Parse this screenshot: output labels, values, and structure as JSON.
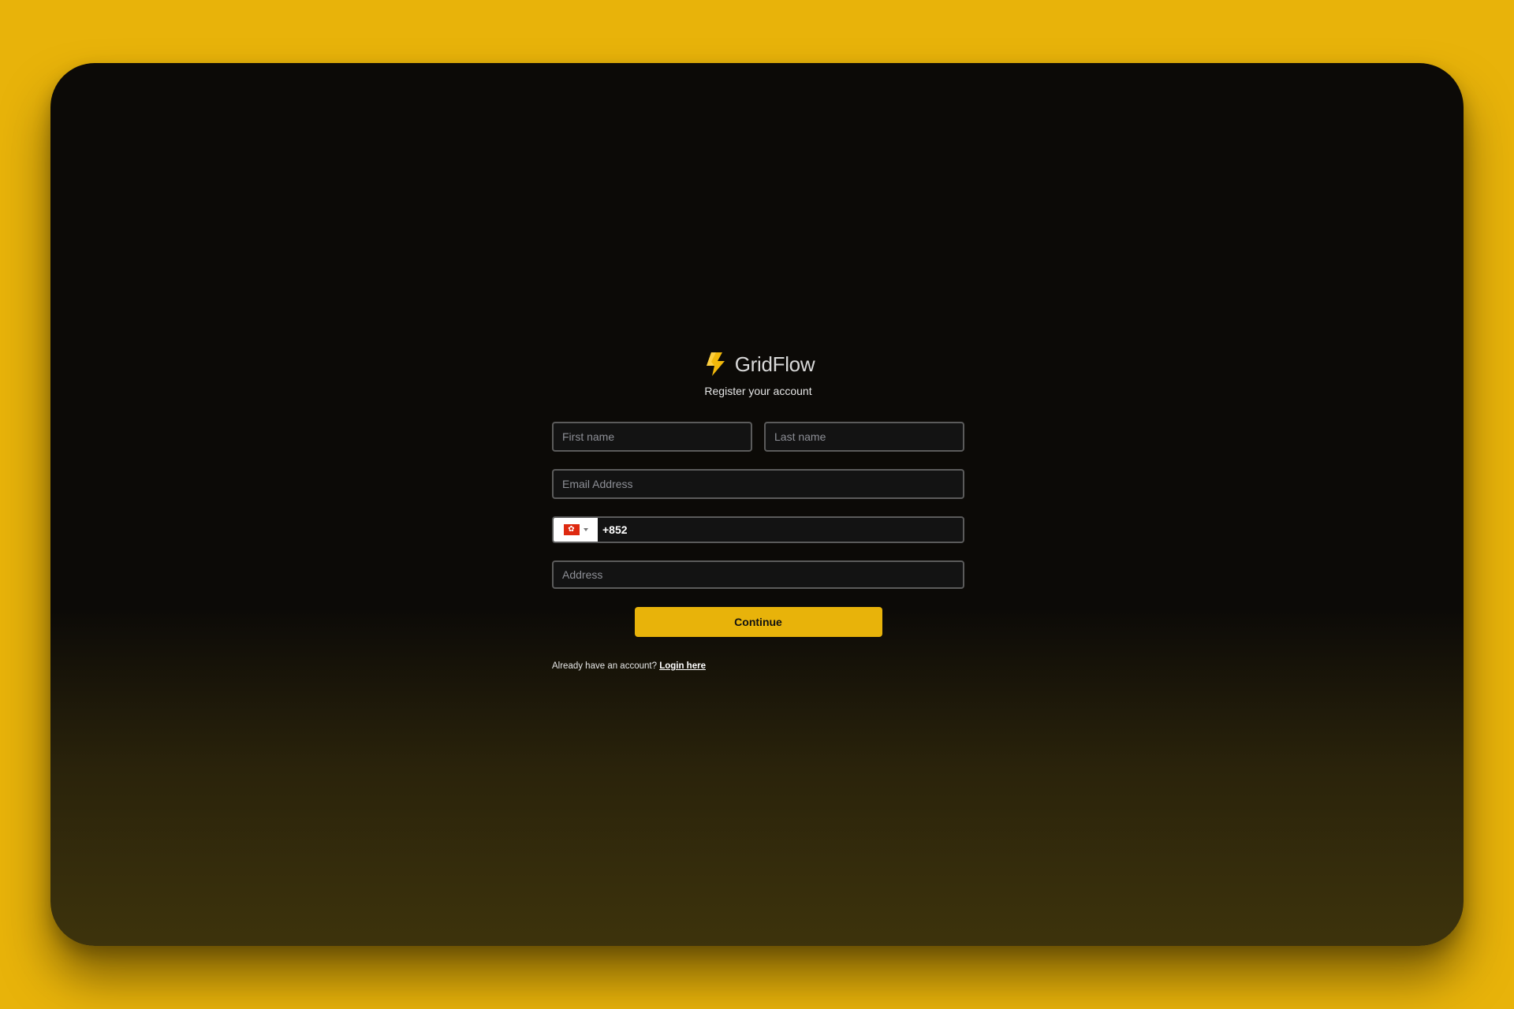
{
  "brand": {
    "name": "GridFlow",
    "logo_icon": "lightning-bolt-icon"
  },
  "subtitle": "Register your account",
  "form": {
    "first_name_placeholder": "First name",
    "last_name_placeholder": "Last name",
    "email_placeholder": "Email Address",
    "phone": {
      "country_flag_icon": "hong-kong-flag-icon",
      "value": "+852"
    },
    "address_placeholder": "Address",
    "continue_label": "Continue"
  },
  "footer": {
    "prompt": "Already have an account?",
    "login_label": "Login here"
  },
  "colors": {
    "accent": "#E8B30A",
    "window_bg_top": "#0c0a07",
    "window_bg_bottom": "#3d330c"
  }
}
